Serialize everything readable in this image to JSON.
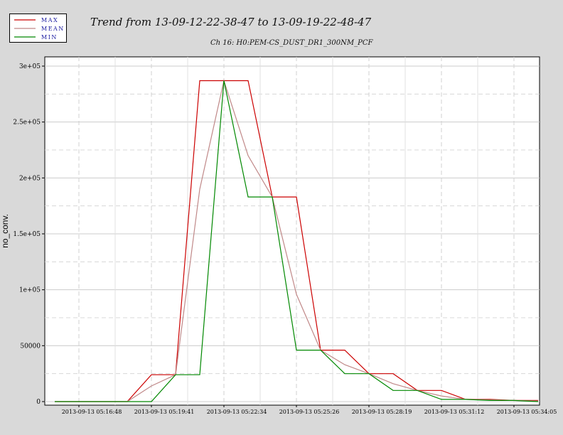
{
  "chart_data": {
    "type": "line",
    "title": "Trend from 13-09-12-22-38-47 to 13-09-19-22-48-47",
    "subtitle": "Ch 16: H0:PEM-CS_DUST_DR1_300NM_PCF",
    "ylabel": "no_conv.",
    "xlabel": "",
    "ylim": [
      0,
      300000
    ],
    "y_ticks": [
      {
        "value": 0,
        "label": "0"
      },
      {
        "value": 50000,
        "label": "50000"
      },
      {
        "value": 100000,
        "label": "1e+05"
      },
      {
        "value": 150000,
        "label": "1.5e+05"
      },
      {
        "value": 200000,
        "label": "2e+05"
      },
      {
        "value": 250000,
        "label": "2.5e+05"
      },
      {
        "value": 300000,
        "label": "3e+05"
      }
    ],
    "x_ticks": [
      "2013-09-13 05:16:48",
      "2013-09-13 05:19:41",
      "2013-09-13 05:22:34",
      "2013-09-13 05:25:26",
      "2013-09-13 05:28:19",
      "2013-09-13 05:31:12",
      "2013-09-13 05:34:05"
    ],
    "x_tick_pos": [
      1,
      4,
      7,
      10,
      13,
      16,
      19
    ],
    "grid": true,
    "legend_position": "top-left",
    "series": [
      {
        "name": "MAX",
        "color": "#cc0000",
        "values": [
          0,
          0,
          0,
          0,
          24000,
          24000,
          287000,
          287000,
          287000,
          183000,
          183000,
          46000,
          46000,
          25000,
          25000,
          10000,
          10000,
          2000,
          2000,
          1000,
          1000
        ]
      },
      {
        "name": "MEAN",
        "color": "#c08888",
        "values": [
          0,
          0,
          0,
          0,
          14000,
          24000,
          190000,
          287000,
          220000,
          183000,
          96000,
          46000,
          33000,
          25000,
          16000,
          10000,
          5000,
          2000,
          1500,
          1000,
          500
        ]
      },
      {
        "name": "MIN",
        "color": "#008800",
        "values": [
          0,
          0,
          0,
          0,
          0,
          24000,
          24000,
          287000,
          183000,
          183000,
          46000,
          46000,
          25000,
          25000,
          10000,
          10000,
          2000,
          2000,
          1000,
          1000,
          0
        ]
      }
    ]
  }
}
